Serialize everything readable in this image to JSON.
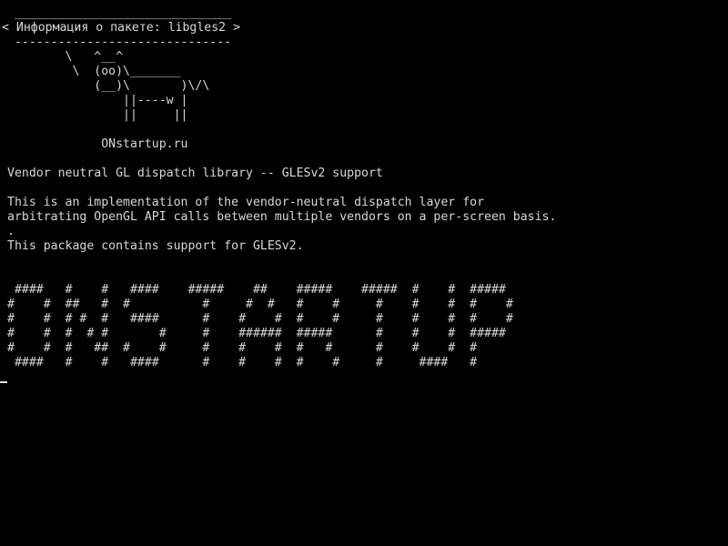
{
  "theme": {
    "background": "#000000",
    "foreground": "#d8d8d8"
  },
  "terminal": {
    "lines": [
      " ______________________________",
      "< Информация о пакете: libgles2 >",
      " ------------------------------",
      "        \\   ^__^",
      "         \\  (oo)\\_______",
      "            (__)\\       )\\/\\",
      "                ||----w |",
      "                ||     ||",
      "",
      "             ONstartup.ru",
      "",
      "Vendor neutral GL dispatch library -- GLESv2 support",
      "",
      "This is an implementation of the vendor-neutral dispatch layer for",
      "arbitrating OpenGL API calls between multiple vendors on a per-screen basis.",
      ".",
      "This package contains support for GLESv2.",
      "",
      "",
      " ####   #    #   ####    #####    ##    #####    #####  #    #  #####",
      "#    #  ##   #  #          #     #  #   #    #     #    #    #  #    #",
      "#    #  # #  #   ####      #    #    #  #    #     #    #    #  #    #",
      "#    #  #  # #       #     #    ######  #####      #    #    #  #####",
      "#    #  #   ##  #    #     #    #    #  #   #      #    #    #  #",
      " ####   #    #   ####      #    #    #  #    #     #     ####   #"
    ]
  }
}
